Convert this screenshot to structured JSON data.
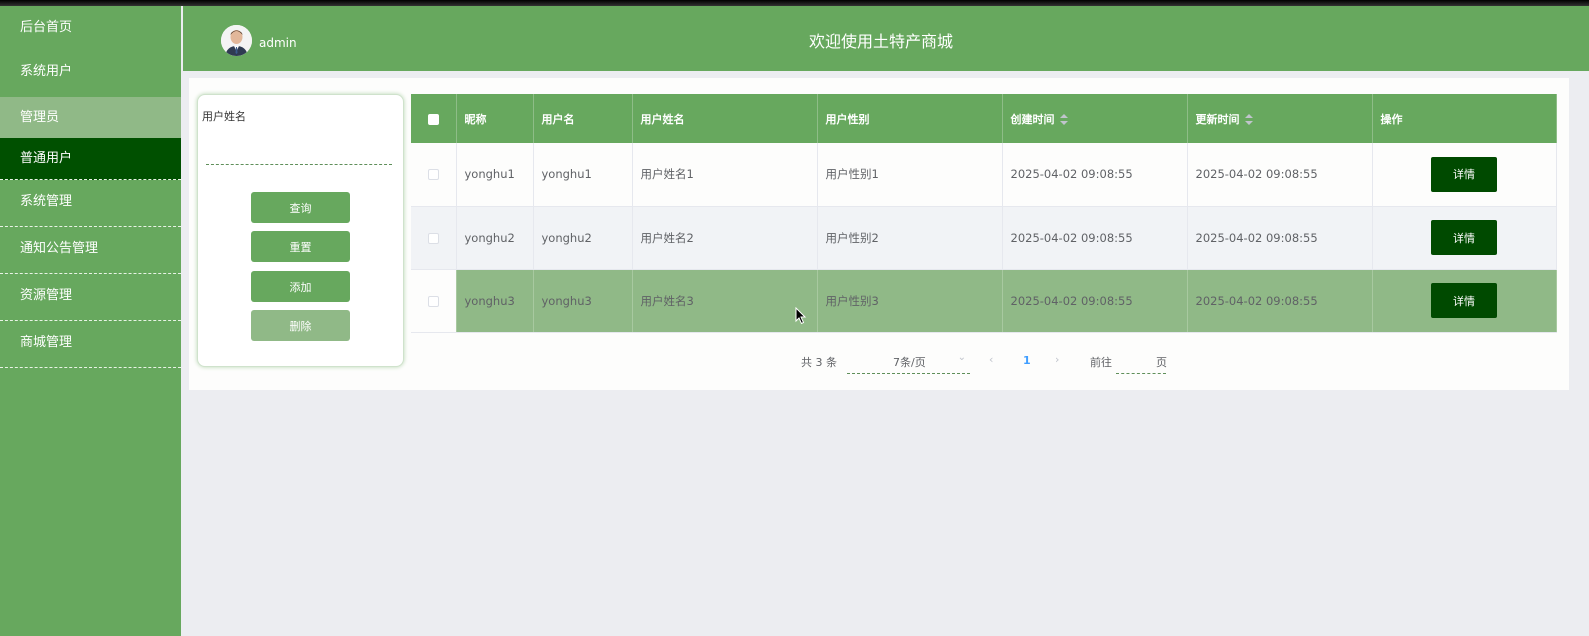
{
  "sidebar": {
    "items": [
      {
        "label": "后台首页"
      },
      {
        "label": "系统用户"
      },
      {
        "label": "管理员"
      },
      {
        "label": "普通用户"
      },
      {
        "label": "系统管理"
      },
      {
        "label": "通知公告管理"
      },
      {
        "label": "资源管理"
      },
      {
        "label": "商城管理"
      }
    ]
  },
  "header": {
    "username": "admin",
    "title": "欢迎使用土特产商城"
  },
  "search": {
    "label": "用户姓名",
    "value": "",
    "query_label": "查询",
    "reset_label": "重置",
    "add_label": "添加",
    "delete_label": "删除"
  },
  "table": {
    "columns": [
      "昵称",
      "用户名",
      "用户姓名",
      "用户性别",
      "创建时间",
      "更新时间",
      "操作"
    ],
    "rows": [
      {
        "nickname": "yonghu1",
        "username": "yonghu1",
        "realname": "用户姓名1",
        "gender": "用户性别1",
        "created": "2025-04-02 09:08:55",
        "updated": "2025-04-02 09:08:55",
        "action": "详情"
      },
      {
        "nickname": "yonghu2",
        "username": "yonghu2",
        "realname": "用户姓名2",
        "gender": "用户性别2",
        "created": "2025-04-02 09:08:55",
        "updated": "2025-04-02 09:08:55",
        "action": "详情"
      },
      {
        "nickname": "yonghu3",
        "username": "yonghu3",
        "realname": "用户姓名3",
        "gender": "用户性别3",
        "created": "2025-04-02 09:08:55",
        "updated": "2025-04-02 09:08:55",
        "action": "详情"
      }
    ]
  },
  "pager": {
    "total": "共 3 条",
    "page_size": "7条/页",
    "current_page": "1",
    "goto_prefix": "前往",
    "goto_value": "",
    "goto_suffix": "页"
  },
  "colors": {
    "primary": "#67a85e",
    "active_menu": "#005000",
    "light_menu": "#90b987",
    "detail_button": "#004a00",
    "page_active": "#409eff"
  },
  "icons": [
    "avatar",
    "checkbox",
    "sort-caret-icon",
    "chevron-down-icon",
    "chevron-left-icon",
    "chevron-right-icon",
    "mouse-cursor-icon"
  ]
}
